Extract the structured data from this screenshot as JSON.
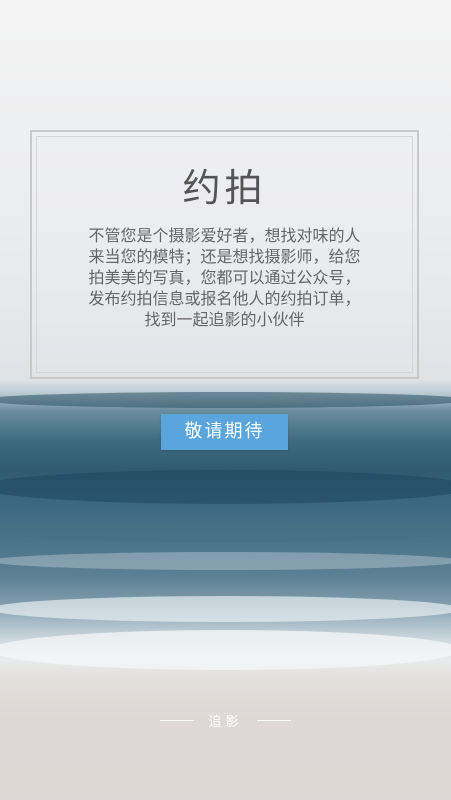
{
  "card": {
    "title": "约拍",
    "description_lines": [
      "不管您是个摄影爱好者，想找对味的人",
      "来当您的模特；还是想找摄影师，给您",
      "拍美美的写真，您都可以通过公众号，",
      "发布约拍信息或报名他人的约拍订单，",
      "找到一起追影的小伙伴"
    ]
  },
  "cta": {
    "label": "敬请期待",
    "color": "#5aa6dc"
  },
  "footer": {
    "brand": "追影"
  }
}
